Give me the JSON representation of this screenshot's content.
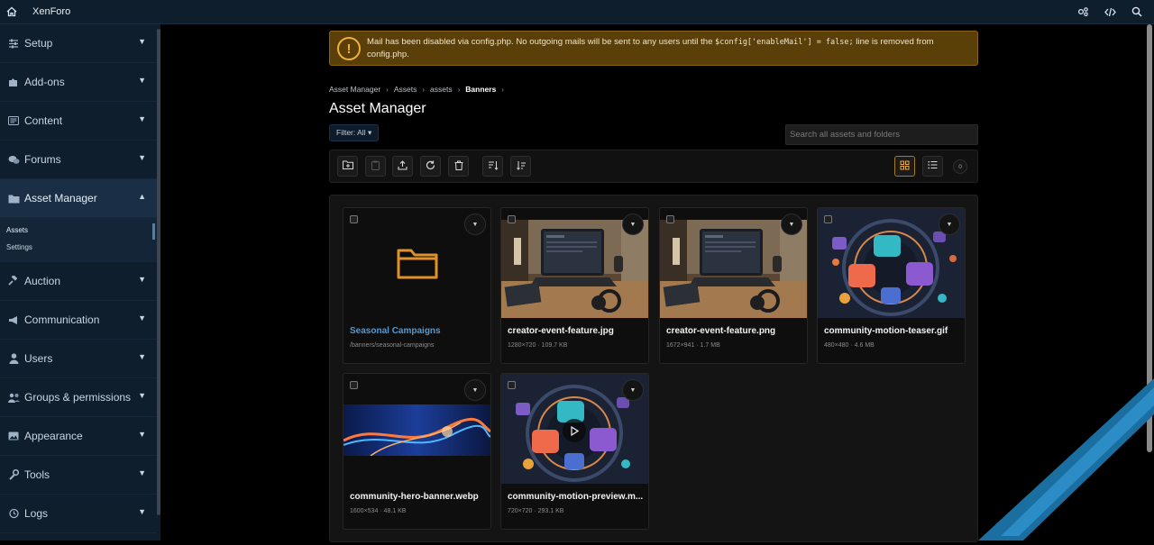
{
  "topbar": {
    "brand": "XenForo",
    "icons": [
      "home-icon",
      "settings-icon",
      "code-icon",
      "search-icon"
    ]
  },
  "sidebar": {
    "sections": [
      {
        "label": "Setup",
        "icon": "sliders-icon"
      },
      {
        "label": "Add-ons",
        "icon": "puzzle-icon"
      },
      {
        "label": "Content",
        "icon": "content-icon"
      },
      {
        "label": "Forums",
        "icon": "comments-icon"
      },
      {
        "label": "Asset Manager",
        "icon": "folder-icon",
        "expanded": true
      },
      {
        "label": "Auction",
        "icon": "gavel-icon"
      },
      {
        "label": "Communication",
        "icon": "megaphone-icon"
      },
      {
        "label": "Users",
        "icon": "user-icon"
      },
      {
        "label": "Groups & permissions",
        "icon": "users-icon"
      },
      {
        "label": "Appearance",
        "icon": "image-icon"
      },
      {
        "label": "Tools",
        "icon": "wrench-icon"
      },
      {
        "label": "Logs",
        "icon": "history-icon"
      }
    ],
    "asset_sub": [
      "Assets",
      "Settings"
    ]
  },
  "notice": {
    "text_before": "Mail has been disabled via config.php. No outgoing mails will be sent to any users until the ",
    "code": "$config['enableMail'] = false;",
    "text_after": " line is removed from config.php."
  },
  "breadcrumb": [
    "Asset Manager",
    "Assets",
    "assets",
    "Banners"
  ],
  "page_title": "Asset Manager",
  "filter_label": "Filter: All",
  "search_placeholder": "Search all assets and folders",
  "selected_count": "0",
  "items": [
    {
      "name": "Seasonal Campaigns",
      "meta": "/banners/seasonal-campaigns",
      "type": "folder"
    },
    {
      "name": "creator-event-feature.jpg",
      "meta": "1280×720 · 109.7 KB",
      "type": "image"
    },
    {
      "name": "creator-event-feature.png",
      "meta": "1672×941 · 1.7 MB",
      "type": "image"
    },
    {
      "name": "community-motion-teaser.gif",
      "meta": "480×480 · 4.6 MB",
      "type": "image"
    },
    {
      "name": "community-hero-banner.webp",
      "meta": "1600×534 · 48.1 KB",
      "type": "image"
    },
    {
      "name": "community-motion-preview.m...",
      "meta": "720×720 · 293.1 KB",
      "type": "video"
    }
  ],
  "colors": {
    "sidebar_bg": "#0f1e2d",
    "notice_bg": "#5a3f08",
    "accent": "#e8b040",
    "folder_link": "#4f9ad8"
  }
}
